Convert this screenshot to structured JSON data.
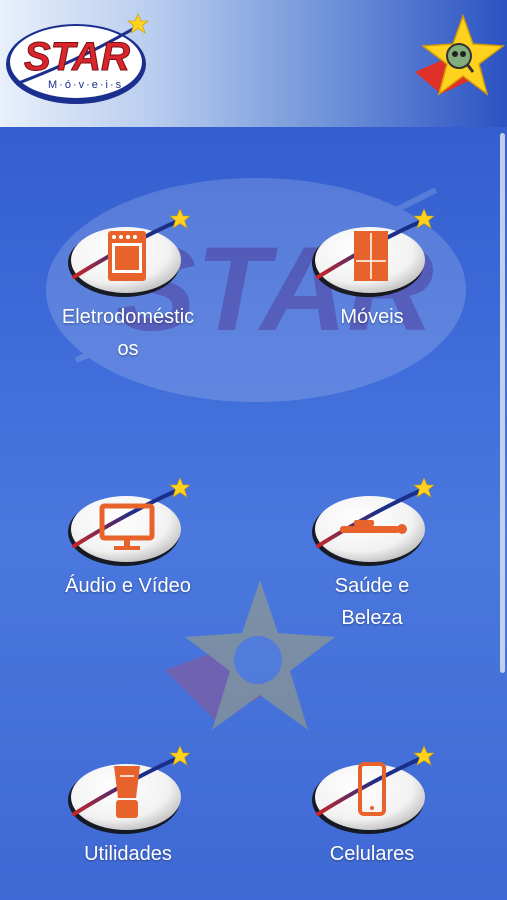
{
  "app": {
    "logo_brand": "STAR",
    "logo_sub": "M·ó·v·e·i·s"
  },
  "categories": [
    {
      "label": "Eletrodomésticos",
      "label_line1": "Eletrodoméstic",
      "label_line2": "os",
      "icon": "stove-icon"
    },
    {
      "label": "Móveis",
      "label_line1": "Móveis",
      "label_line2": "",
      "icon": "wardrobe-icon"
    },
    {
      "label": "Áudio e Vídeo",
      "label_line1": "Áudio e Vídeo",
      "label_line2": "",
      "icon": "monitor-icon"
    },
    {
      "label": "Saúde e Beleza",
      "label_line1": "Saúde e",
      "label_line2": "Beleza",
      "icon": "hair-straightener-icon"
    },
    {
      "label": "Utilidades",
      "label_line1": "Utilidades",
      "label_line2": "",
      "icon": "blender-icon"
    },
    {
      "label": "Celulares",
      "label_line1": "Celulares",
      "label_line2": "",
      "icon": "smartphone-icon"
    }
  ],
  "colors": {
    "background": "#3d6ad8",
    "logo_red": "#d8262c",
    "icon_orange": "#e8632c",
    "star_yellow": "#ffd21f"
  }
}
